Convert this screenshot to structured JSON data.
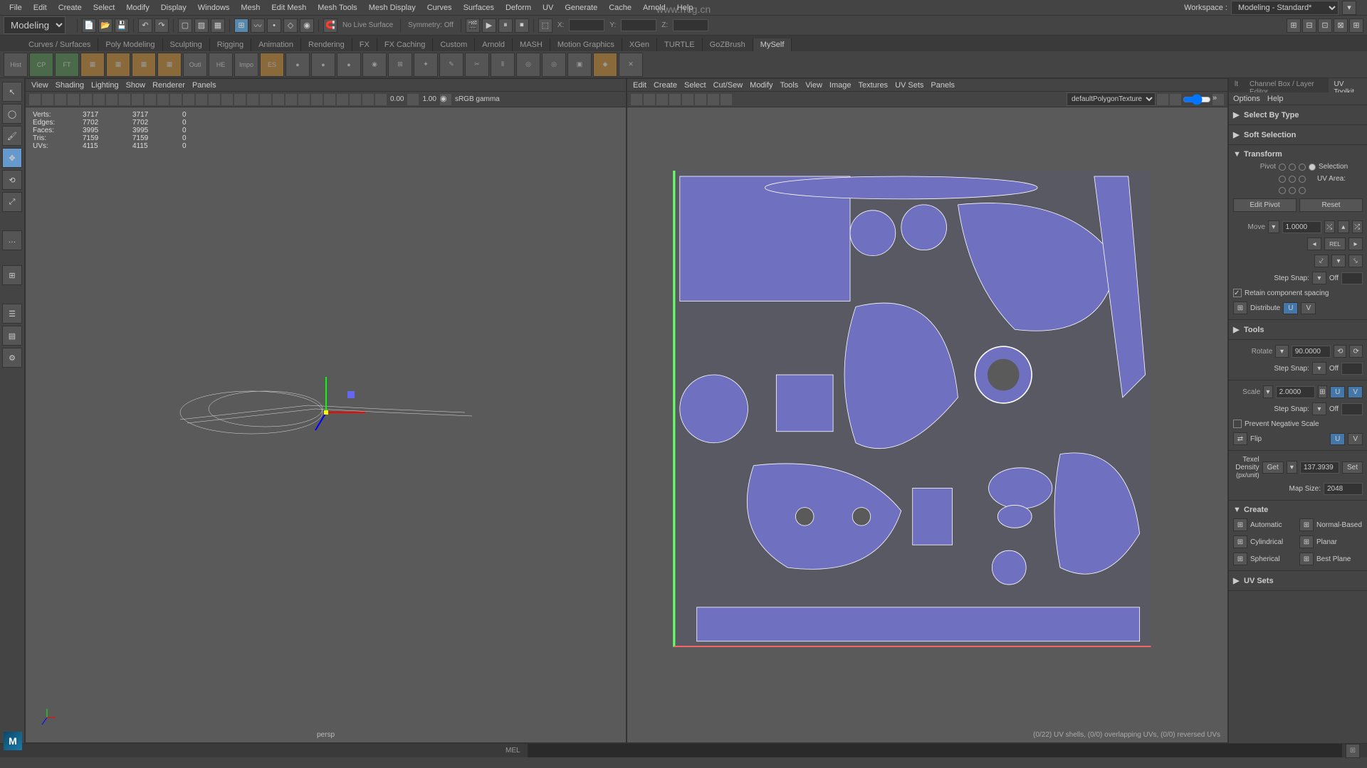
{
  "watermark": "www.rrcg.cn",
  "menubar": [
    "File",
    "Edit",
    "Create",
    "Select",
    "Modify",
    "Display",
    "Windows",
    "Mesh",
    "Edit Mesh",
    "Mesh Tools",
    "Mesh Display",
    "Curves",
    "Surfaces",
    "Deform",
    "UV",
    "Generate",
    "Cache",
    "Arnold",
    "Help"
  ],
  "workspace": {
    "label": "Workspace :",
    "value": "Modeling - Standard*"
  },
  "mode": "Modeling",
  "toolbar2": {
    "nolive": "No Live Surface",
    "symmetry": "Symmetry: Off",
    "x_label": "X:",
    "y_label": "Y:",
    "z_label": "Z:"
  },
  "shelves": [
    "Curves / Surfaces",
    "Poly Modeling",
    "Sculpting",
    "Rigging",
    "Animation",
    "Rendering",
    "FX",
    "FX Caching",
    "Custom",
    "Arnold",
    "MASH",
    "Motion Graphics",
    "XGen",
    "TURTLE",
    "GoZBrush",
    "MySelf"
  ],
  "shelf_active": "MySelf",
  "shelf_labels": [
    "Hist",
    "CP",
    "FT",
    "",
    "",
    "",
    "Outl",
    "HE",
    "Impo",
    "ES"
  ],
  "viewport1": {
    "menus": [
      "View",
      "Shading",
      "Lighting",
      "Show",
      "Renderer",
      "Panels"
    ],
    "num1": "0.00",
    "num2": "1.00",
    "gamma": "sRGB gamma",
    "label": "persp",
    "hud": [
      {
        "label": "Verts:",
        "v1": "3717",
        "v2": "3717",
        "v3": "0"
      },
      {
        "label": "Edges:",
        "v1": "7702",
        "v2": "7702",
        "v3": "0"
      },
      {
        "label": "Faces:",
        "v1": "3995",
        "v2": "3995",
        "v3": "0"
      },
      {
        "label": "Tris:",
        "v1": "7159",
        "v2": "7159",
        "v3": "0"
      },
      {
        "label": "UVs:",
        "v1": "4115",
        "v2": "4115",
        "v3": "0"
      }
    ]
  },
  "viewport2": {
    "menus": [
      "Edit",
      "Create",
      "Select",
      "Cut/Sew",
      "Modify",
      "Tools",
      "View",
      "Image",
      "Textures",
      "UV Sets",
      "Panels"
    ],
    "texture": "defaultPolygonTexture",
    "status": "(0/22) UV shells, (0/0) overlapping UVs, (0/0) reversed UVs"
  },
  "right_panel": {
    "tabs": [
      "lt",
      "Channel Box / Layer Editor",
      "UV Toolkit"
    ],
    "active_tab": "UV Toolkit",
    "menu": [
      "Options",
      "Help"
    ],
    "select_by_type": "Select By Type",
    "soft_selection": "Soft Selection",
    "transform": {
      "title": "Transform",
      "pivot": "Pivot",
      "selection": "Selection",
      "uv_area": "UV Area:",
      "edit_pivot": "Edit Pivot",
      "reset": "Reset",
      "move": "Move",
      "move_val": "1.0000",
      "rel": "REL",
      "step_snap": "Step Snap:",
      "off": "Off",
      "retain": "Retain component spacing",
      "distribute": "Distribute",
      "u": "U",
      "v": "V"
    },
    "tools": {
      "title": "Tools"
    },
    "rotate": {
      "label": "Rotate",
      "val": "90.0000"
    },
    "scale": {
      "label": "Scale",
      "val": "2.0000",
      "prevent": "Prevent Negative Scale",
      "flip": "Flip"
    },
    "texel": {
      "label": "Texel Density",
      "unit": "(px/unit)",
      "get": "Get",
      "val": "137.3939",
      "set": "Set",
      "mapsize": "Map Size:",
      "mapval": "2048"
    },
    "create": {
      "title": "Create",
      "auto": "Automatic",
      "normal": "Normal-Based",
      "cyl": "Cylindrical",
      "planar": "Planar",
      "sph": "Spherical",
      "best": "Best Plane"
    },
    "uvsets": "UV Sets"
  },
  "statusbar": {
    "mel": "MEL"
  }
}
